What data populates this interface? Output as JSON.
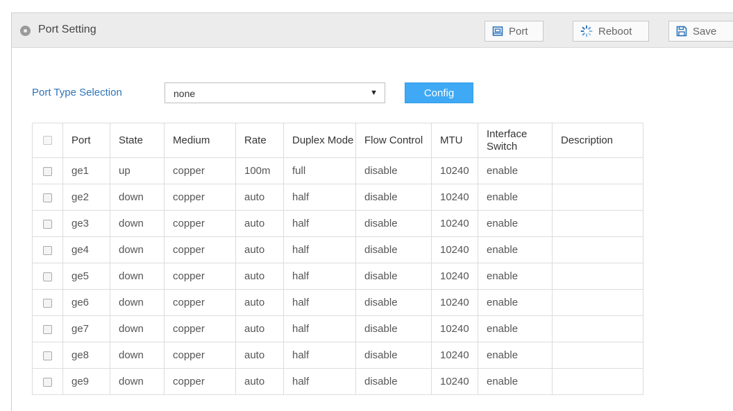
{
  "header": {
    "title": "Port Setting",
    "buttons": {
      "port": "Port",
      "reboot": "Reboot",
      "save": "Save"
    }
  },
  "filter": {
    "label": "Port Type Selection",
    "selected": "none",
    "config_label": "Config"
  },
  "table": {
    "columns": [
      "Port",
      "State",
      "Medium",
      "Rate",
      "Duplex Mode",
      "Flow Control",
      "MTU",
      "Interface Switch",
      "Description"
    ],
    "rows": [
      [
        "ge1",
        "up",
        "copper",
        "100m",
        "full",
        "disable",
        "10240",
        "enable",
        ""
      ],
      [
        "ge2",
        "down",
        "copper",
        "auto",
        "half",
        "disable",
        "10240",
        "enable",
        ""
      ],
      [
        "ge3",
        "down",
        "copper",
        "auto",
        "half",
        "disable",
        "10240",
        "enable",
        ""
      ],
      [
        "ge4",
        "down",
        "copper",
        "auto",
        "half",
        "disable",
        "10240",
        "enable",
        ""
      ],
      [
        "ge5",
        "down",
        "copper",
        "auto",
        "half",
        "disable",
        "10240",
        "enable",
        ""
      ],
      [
        "ge6",
        "down",
        "copper",
        "auto",
        "half",
        "disable",
        "10240",
        "enable",
        ""
      ],
      [
        "ge7",
        "down",
        "copper",
        "auto",
        "half",
        "disable",
        "10240",
        "enable",
        ""
      ],
      [
        "ge8",
        "down",
        "copper",
        "auto",
        "half",
        "disable",
        "10240",
        "enable",
        ""
      ],
      [
        "ge9",
        "down",
        "copper",
        "auto",
        "half",
        "disable",
        "10240",
        "enable",
        ""
      ]
    ]
  },
  "icons": {
    "header": "circle-dot-icon",
    "port": "port-icon",
    "reboot": "reboot-spinner-icon",
    "save": "floppy-disk-icon"
  },
  "colors": {
    "accent": "#3fa9f5",
    "label_blue": "#2d74b8",
    "header_bg": "#ececec"
  }
}
